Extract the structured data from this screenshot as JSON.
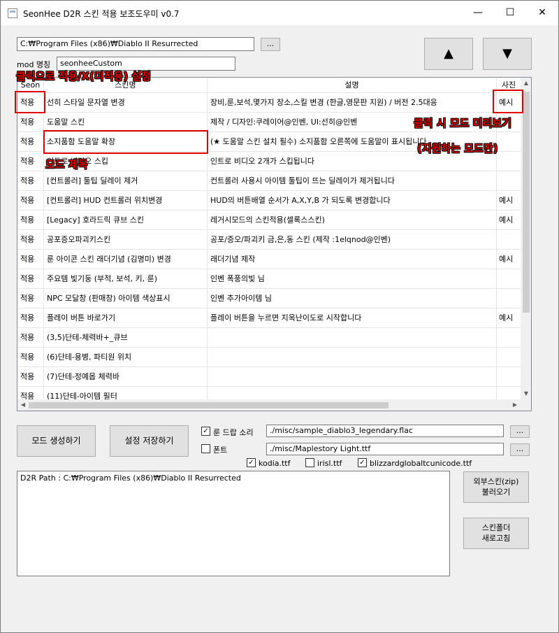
{
  "window": {
    "title": "SeonHee D2R 스킨 적용 보조도우미 v0.7",
    "minimize": "—",
    "maximize": "☐",
    "close": "✕"
  },
  "top": {
    "path_value": "C:₩Program Files (x86)₩Diablo II Resurrected",
    "browse_label": "...",
    "mod_label": "mod 명칭",
    "mod_value": "seonheeCustom",
    "up_label": "▲",
    "down_label": "▼"
  },
  "grid": {
    "headers": [
      "Seon",
      "스킨명",
      "설명",
      "사진"
    ],
    "rows": [
      {
        "apply": "적용",
        "name": "선히 스타일 문자열 변경",
        "desc": "장비,룬,보석,몇가지 장소,스킬 변경 (한글,영문판 지원) / 버전 2.5대응",
        "photo": "예시"
      },
      {
        "apply": "적용",
        "name": "도움말 스킨",
        "desc": "제작 / 디자인:쿠레이어@인벤, UI:선히@인벤",
        "photo": ""
      },
      {
        "apply": "적용",
        "name": "소지품함 도움말 확장",
        "desc": "(★ 도움말 스킨 설치 필수) 소지품함 오른쪽에 도움말이 표시됩니다",
        "photo": ""
      },
      {
        "apply": "적용",
        "name": "인트로 비디오 스킵",
        "desc": "인트로 비디오 2개가 스킵됩니다",
        "photo": ""
      },
      {
        "apply": "적용",
        "name": "[컨트롤러] 툴팁 딜레이 제거",
        "desc": "컨트롤러 사용시 아이템 툴팁이 뜨는 딜레이가 제거됩니다",
        "photo": ""
      },
      {
        "apply": "적용",
        "name": "[컨트롤러] HUD 컨트롤러 위치변경",
        "desc": "HUD의 버튼배열 순서가 A,X,Y,B 가 되도록 변경합니다",
        "photo": "예시"
      },
      {
        "apply": "적용",
        "name": "[Legacy] 호라드릭 큐브 스킨",
        "desc": "레거시모드의 스킨적용(셀록스스킨)",
        "photo": "예시"
      },
      {
        "apply": "적용",
        "name": "공포증오파괴키스킨",
        "desc": "공포/증오/파괴키 금,은,동 스킨 (제작 :1elqnod@인벤)",
        "photo": ""
      },
      {
        "apply": "적용",
        "name": "룬 아이콘 스킨 래더기념 (김명미) 변경",
        "desc": "래더기념 제작",
        "photo": "예시"
      },
      {
        "apply": "적용",
        "name": "주요템 빛기둥 (부적, 보석, 키, 룬)",
        "desc": "인벤 폭풍의빛 님",
        "photo": ""
      },
      {
        "apply": "적용",
        "name": "NPC 모달창 (판매창) 아이템 색상표시",
        "desc": "인벤 추가아이템 님",
        "photo": ""
      },
      {
        "apply": "적용",
        "name": "플레이 버튼 바로가기",
        "desc": "플레이 버튼을 누르면 지옥난이도로 시작합니다",
        "photo": "예시"
      },
      {
        "apply": "적용",
        "name": "(3,5)단테-체력바+_큐브",
        "desc": "",
        "photo": ""
      },
      {
        "apply": "적용",
        "name": "(6)단테-용병, 파티원 위치",
        "desc": "",
        "photo": ""
      },
      {
        "apply": "적용",
        "name": "(7)단테-정예몹 체력바",
        "desc": "",
        "photo": ""
      },
      {
        "apply": "적용",
        "name": "(11)단테-아이템 필터",
        "desc": "",
        "photo": ""
      }
    ]
  },
  "scroll_icons": {
    "up": "▲",
    "down": "▼",
    "left": "◀",
    "right": "▶"
  },
  "options": {
    "generate_label": "모드 생성하기",
    "save_label": "설정 저장하기",
    "rune_sound_label": "룬 드랍 소리",
    "rune_sound_checked": "✓",
    "rune_sound_value": "./misc/sample_diablo3_legendary.flac",
    "font_label": "폰트",
    "font_checked": "",
    "font_value": "./misc/Maplestory Light.ttf",
    "browse_label": "...",
    "kodia_label": "kodia.ttf",
    "kodia_checked": "✓",
    "irisl_label": "irisl.ttf",
    "irisl_checked": "",
    "blizz_label": "blizzardglobaltcunicode.ttf",
    "blizz_checked": "✓"
  },
  "log": {
    "text": "D2R Path : C:₩Program Files (x86)₩Diablo II Resurrected"
  },
  "side": {
    "zip_line1": "외부스킨(zip)",
    "zip_line2": "불러오기",
    "refresh_line1": "스킨폴더",
    "refresh_line2": "새로고침"
  },
  "annotations": {
    "click_apply": "클릭으로 적용/X(미적용) 설정",
    "mod_title": "모드 제목",
    "preview_line1": "클릭 시 모드 미리보기",
    "preview_line2": "(지원하는 모드만)"
  },
  "colors": {
    "annotation_red": "#e00000"
  }
}
